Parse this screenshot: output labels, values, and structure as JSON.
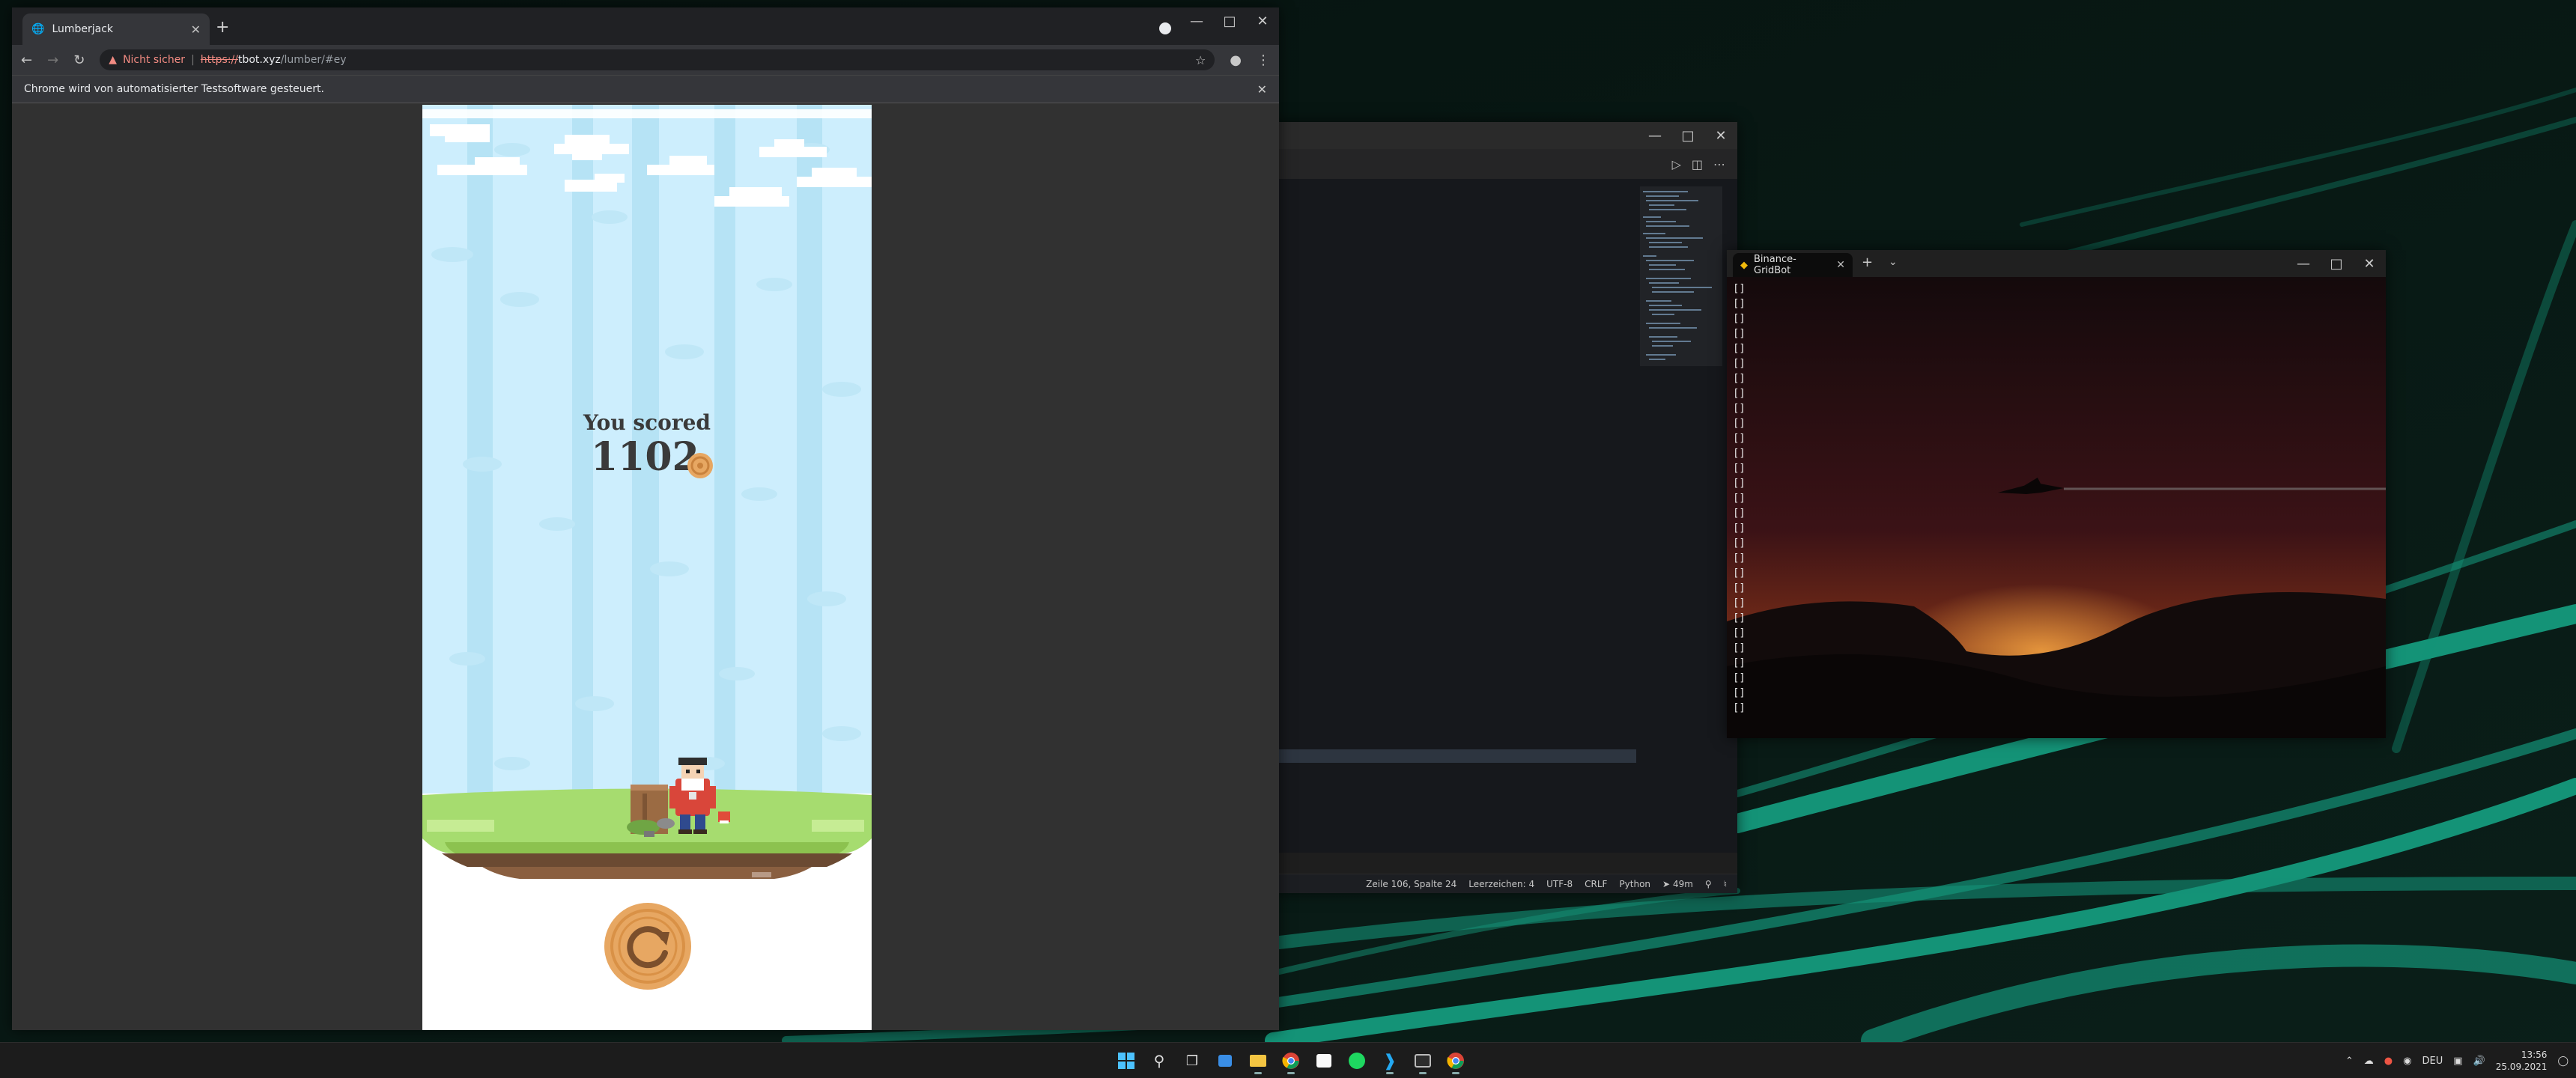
{
  "chrome": {
    "tab_title": "Lumberjack",
    "omnibox": {
      "security_label": "Nicht sicher",
      "scheme": "https://",
      "host": "tbot.xyz",
      "path": "/lumber/#ey"
    },
    "infobar_text": "Chrome wird von automatisierter Testsoftware gesteuert."
  },
  "game": {
    "score_label": "You scored",
    "score_value": "1102"
  },
  "vscode": {
    "status": {
      "position": "Zeile 106, Spalte 24",
      "indent": "Leerzeichen: 4",
      "encoding": "UTF-8",
      "eol": "CRLF",
      "language": "Python",
      "time": "49m"
    }
  },
  "terminal": {
    "tab_title": "Binance-GridBot",
    "lines": [
      "[]",
      "[]",
      "[]",
      "[]",
      "[]",
      "[]",
      "[]",
      "[]",
      "[]",
      "[]",
      "[]",
      "[]",
      "[]",
      "[]",
      "[]",
      "[]",
      "[]",
      "[]",
      "[]",
      "[]",
      "[]",
      "[]",
      "[]",
      "[]",
      "[]",
      "[]",
      "[]",
      "[]",
      "[]"
    ]
  },
  "taskbar": {
    "language": "DEU",
    "time": "13:56",
    "date": "25.09.2021"
  },
  "colors": {
    "accent_teal": "#17a98a",
    "sky": "#cdeefd",
    "grass": "#a6dc6f",
    "restart_orange": "#e7a762"
  }
}
